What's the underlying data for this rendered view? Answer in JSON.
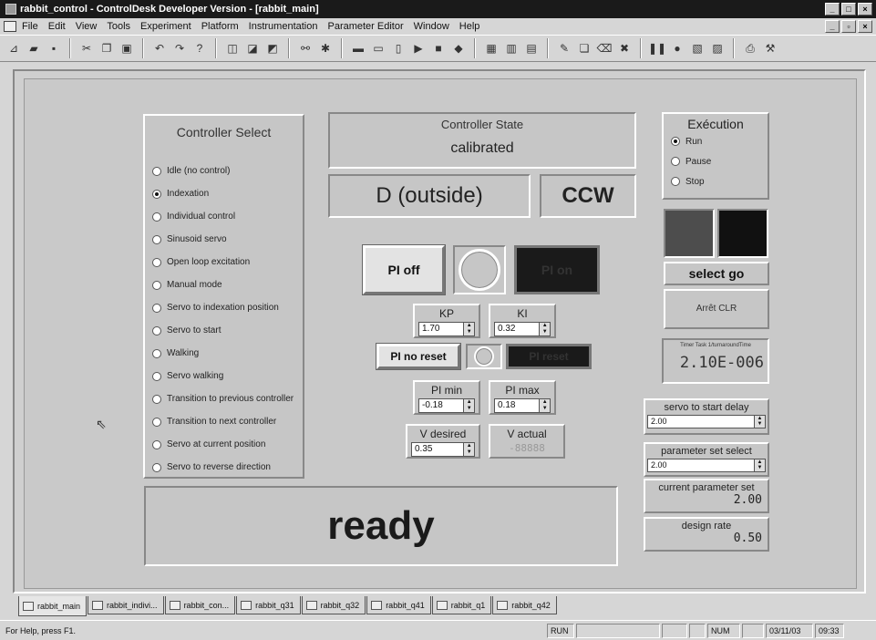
{
  "window": {
    "title": "rabbit_control - ControlDesk Developer Version - [rabbit_main]"
  },
  "menu": [
    "File",
    "Edit",
    "View",
    "Tools",
    "Experiment",
    "Platform",
    "Instrumentation",
    "Parameter Editor",
    "Window",
    "Help"
  ],
  "controller_select": {
    "heading": "Controller Select",
    "options": [
      {
        "label": "Idle (no control)",
        "selected": false
      },
      {
        "label": "Indexation",
        "selected": true
      },
      {
        "label": "Individual control",
        "selected": false
      },
      {
        "label": "Sinusoid servo",
        "selected": false
      },
      {
        "label": "Open loop excitation",
        "selected": false
      },
      {
        "label": "Manual mode",
        "selected": false
      },
      {
        "label": "Servo to indexation position",
        "selected": false
      },
      {
        "label": "Servo to start",
        "selected": false
      },
      {
        "label": "Walking",
        "selected": false
      },
      {
        "label": "Servo walking",
        "selected": false
      },
      {
        "label": "Transition to previous controller",
        "selected": false
      },
      {
        "label": "Transition to next controller",
        "selected": false
      },
      {
        "label": "Servo at current position",
        "selected": false
      },
      {
        "label": "Servo to reverse direction",
        "selected": false
      }
    ]
  },
  "controller_state": {
    "label": "Controller State",
    "value": "calibrated",
    "direction": "D (outside)",
    "rotation": "CCW"
  },
  "pi": {
    "off_label": "PI off",
    "on_label": "PI on",
    "noreset_label": "PI no reset",
    "reset_label": "PI reset",
    "kp_label": "KP",
    "kp_value": "1.70",
    "ki_label": "KI",
    "ki_value": "0.32",
    "pimin_label": "PI min",
    "pimin_value": "-0.18",
    "pimax_label": "PI max",
    "pimax_value": "0.18",
    "vdesired_label": "V desired",
    "vdesired_value": "0.35",
    "vactual_label": "V actual",
    "vactual_value": "-88888"
  },
  "status": {
    "text": "ready"
  },
  "execution": {
    "heading": "Exécution",
    "options": [
      {
        "label": "Run",
        "selected": true
      },
      {
        "label": "Pause",
        "selected": false
      },
      {
        "label": "Stop",
        "selected": false
      }
    ],
    "select_go": "select go",
    "arret": "Arrêt CLR"
  },
  "timer": {
    "label": "Timer Task 1/turnaroundTime",
    "value": "2.10E-006"
  },
  "right_params": {
    "servo_delay_label": "servo to start delay",
    "servo_delay_value": "2.00",
    "param_select_label": "parameter set select",
    "param_select_value": "2.00",
    "cur_param_label": "current parameter set",
    "cur_param_value": "2.00",
    "design_label": "design rate",
    "design_value": "0.50"
  },
  "tabs": [
    "rabbit_main",
    "rabbit_indivi...",
    "rabbit_con...",
    "rabbit_q31",
    "rabbit_q32",
    "rabbit_q41",
    "rabbit_q1",
    "rabbit_q42"
  ],
  "statusbar": {
    "help": "For Help, press F1.",
    "run": "RUN",
    "num": "NUM",
    "date": "03/11/03",
    "time": "09:33"
  }
}
